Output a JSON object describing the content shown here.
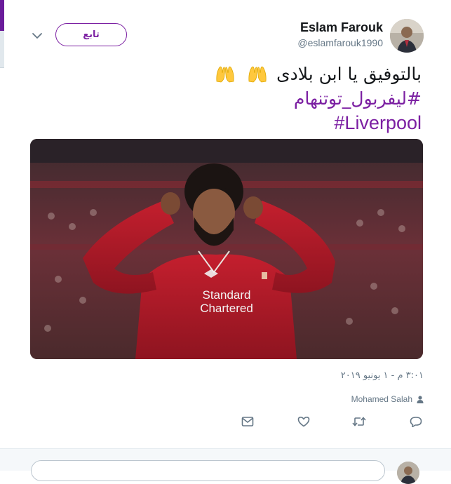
{
  "tweet": {
    "author_name": "Eslam Farouk",
    "author_handle": "@eslamfarouk1990",
    "follow_label": "تابع",
    "text_line1": "بالتوفيق يا ابن بلادى",
    "hashtag1": "#ليفربول_توتنهام",
    "hashtag2": "#Liverpool",
    "timestamp": "٣:٠١ م - ١ يونيو ٢٠١٩",
    "tagged_user": "Mohamed Salah",
    "image_sign_line1": "Standard",
    "image_sign_line2": "Chartered"
  },
  "icons": {
    "menu": "chevron-down-icon",
    "emoji": "raising-hands-emoji",
    "tag": "person-icon",
    "actions": [
      "reply-icon",
      "retweet-icon",
      "like-icon",
      "direct-message-icon"
    ]
  },
  "colors": {
    "accent": "#7b1fa2",
    "muted": "#657786",
    "jersey": "#b0182a"
  }
}
